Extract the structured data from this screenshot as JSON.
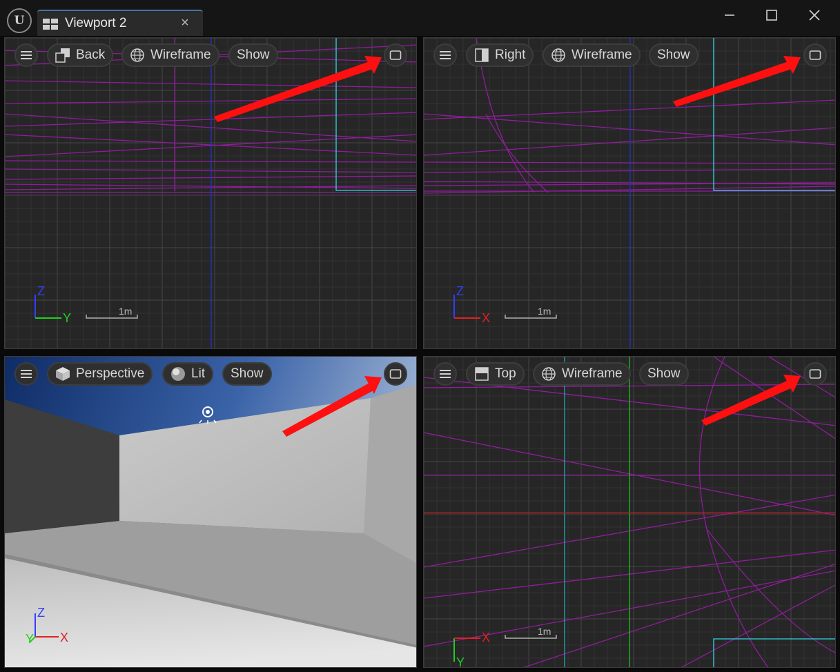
{
  "window": {
    "tab_title": "Viewport 2",
    "tab_close": "×",
    "logo_glyph": "U"
  },
  "viewports": {
    "top_left": {
      "view_label": "Back",
      "mode_label": "Wireframe",
      "show_label": "Show",
      "axis_vertical": "Z",
      "axis_horizontal": "Y",
      "scale_label": "1m"
    },
    "top_right": {
      "view_label": "Right",
      "mode_label": "Wireframe",
      "show_label": "Show",
      "axis_vertical": "Z",
      "axis_horizontal": "X",
      "scale_label": "1m"
    },
    "bottom_left": {
      "view_label": "Perspective",
      "mode_label": "Lit",
      "show_label": "Show",
      "axis_vertical": "Z",
      "axis_horizontal": "X",
      "axis_depth": "Y"
    },
    "bottom_right": {
      "view_label": "Top",
      "mode_label": "Wireframe",
      "show_label": "Show",
      "axis_horizontal": "X",
      "axis_vertical": "Y",
      "scale_label": "1m"
    }
  },
  "colors": {
    "grid_bg": "#262626",
    "grid_line": "#333333",
    "grid_major": "#474747",
    "wire_magenta": "#9a1ea6",
    "axis_z": "#3040ff",
    "axis_y": "#20d020",
    "axis_x": "#e02020",
    "cyan": "#34d6e6",
    "annotation_arrow": "#ff1010"
  },
  "icons": {
    "menu": "hamburger-icon",
    "back_view": "back-view-icon",
    "right_view": "right-view-icon",
    "top_view": "top-view-icon",
    "perspective": "cube-icon",
    "wireframe": "wireframe-sphere-icon",
    "lit": "lit-sphere-icon",
    "maximize": "maximize-viewport-icon"
  }
}
